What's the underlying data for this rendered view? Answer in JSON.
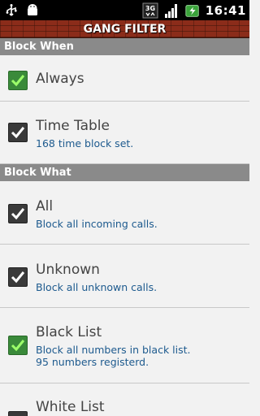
{
  "status_bar": {
    "icons_left": [
      "usb-icon",
      "android-icon"
    ],
    "icons_right": [
      "3g-icon",
      "signal-icon",
      "battery-charging-icon"
    ],
    "time": "16:41"
  },
  "title": "GANG FILTER",
  "sections": [
    {
      "header": "Block When",
      "items": [
        {
          "label": "Always",
          "checked": true,
          "check_style": "green"
        },
        {
          "label": "Time Table",
          "sub": "168 time block set.",
          "checked": true,
          "check_style": "dark"
        }
      ]
    },
    {
      "header": "Block What",
      "items": [
        {
          "label": "All",
          "sub": "Block all incoming calls.",
          "checked": true,
          "check_style": "dark"
        },
        {
          "label": "Unknown",
          "sub": "Block all unknown calls.",
          "checked": true,
          "check_style": "dark"
        },
        {
          "label": "Black List",
          "sub": "Block all numbers in black list.",
          "sub2": "95 numbers registerd.",
          "checked": true,
          "check_style": "green"
        },
        {
          "label": "White List",
          "checked": false,
          "check_style": "dark"
        }
      ]
    }
  ],
  "colors": {
    "status_bar": "#000000",
    "title_brick": "#8b2c1a",
    "section_header": "#8a8a8a",
    "background": "#f2f2f2",
    "sub_text": "#1d5a8e",
    "check_green": "#3a8a3a",
    "check_dark": "#3a3a3a"
  }
}
